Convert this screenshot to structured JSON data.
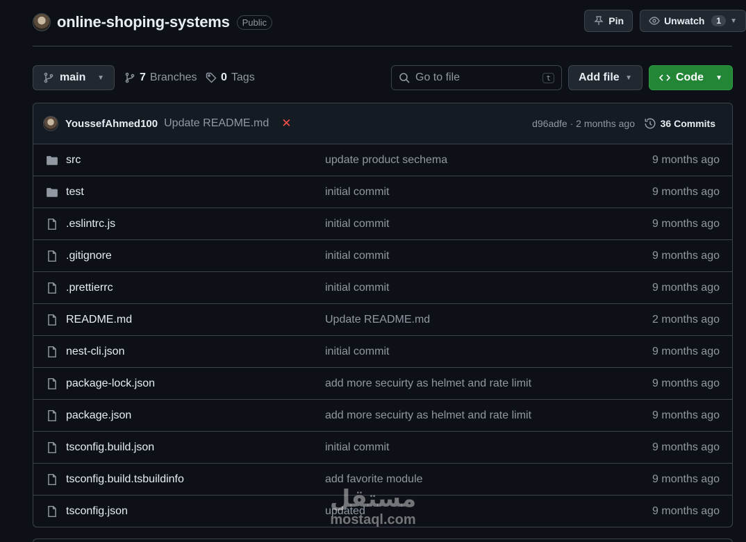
{
  "repo": {
    "name": "online-shoping-systems",
    "visibility": "Public"
  },
  "actions": {
    "pin_label": "Pin",
    "watch_label": "Unwatch",
    "watch_count": "1"
  },
  "toolbar": {
    "branch": "main",
    "branches_count": "7",
    "branches_label": "Branches",
    "tags_count": "0",
    "tags_label": "Tags",
    "search_placeholder": "Go to file",
    "search_shortcut": "t",
    "add_file_label": "Add file",
    "code_label": "Code"
  },
  "latest_commit": {
    "author": "YoussefAhmed100",
    "message": "Update README.md",
    "status_symbol": "✕",
    "status_color": "#f85149",
    "meta": "d96adfe · 2 months ago",
    "commits_label": "36 Commits"
  },
  "files": [
    {
      "type": "folder",
      "name": "src",
      "commit": "update product sechema",
      "time": "9 months ago"
    },
    {
      "type": "folder",
      "name": "test",
      "commit": "initial commit",
      "time": "9 months ago"
    },
    {
      "type": "file",
      "name": ".eslintrc.js",
      "commit": "initial commit",
      "time": "9 months ago"
    },
    {
      "type": "file",
      "name": ".gitignore",
      "commit": "initial commit",
      "time": "9 months ago"
    },
    {
      "type": "file",
      "name": ".prettierrc",
      "commit": "initial commit",
      "time": "9 months ago"
    },
    {
      "type": "file",
      "name": "README.md",
      "commit": "Update README.md",
      "time": "2 months ago"
    },
    {
      "type": "file",
      "name": "nest-cli.json",
      "commit": "initial commit",
      "time": "9 months ago"
    },
    {
      "type": "file",
      "name": "package-lock.json",
      "commit": "add more secuirty as helmet and rate limit",
      "time": "9 months ago"
    },
    {
      "type": "file",
      "name": "package.json",
      "commit": "add more secuirty as helmet and rate limit",
      "time": "9 months ago"
    },
    {
      "type": "file",
      "name": "tsconfig.build.json",
      "commit": "initial commit",
      "time": "9 months ago"
    },
    {
      "type": "file",
      "name": "tsconfig.build.tsbuildinfo",
      "commit": "add favorite module",
      "time": "9 months ago"
    },
    {
      "type": "file",
      "name": "tsconfig.json",
      "commit": "updated",
      "time": "9 months ago"
    }
  ],
  "watermark": {
    "arabic": "مستقل",
    "latin": "mostaql.com"
  }
}
